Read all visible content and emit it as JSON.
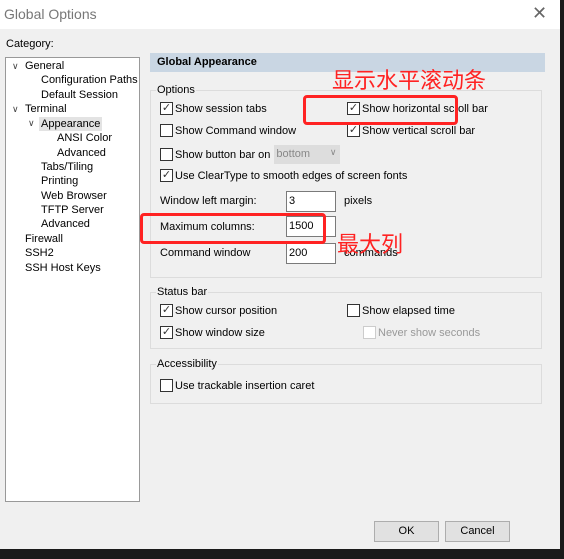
{
  "window": {
    "title": "Global Options",
    "close_icon": "close-icon"
  },
  "category_label": "Category:",
  "tree": [
    {
      "label": "General",
      "expanded": true
    },
    {
      "label": "Configuration Paths"
    },
    {
      "label": "Default Session"
    },
    {
      "label": "Terminal",
      "expanded": true
    },
    {
      "label": "Appearance",
      "expanded": true,
      "selected": true
    },
    {
      "label": "ANSI Color"
    },
    {
      "label": "Advanced"
    },
    {
      "label": "Tabs/Tiling"
    },
    {
      "label": "Printing"
    },
    {
      "label": "Web Browser"
    },
    {
      "label": "TFTP Server"
    },
    {
      "label": "Advanced"
    },
    {
      "label": "Firewall"
    },
    {
      "label": "SSH2"
    },
    {
      "label": "SSH Host Keys"
    }
  ],
  "panel": {
    "title": "Global Appearance"
  },
  "options": {
    "label": "Options",
    "show_session_tabs": {
      "label": "Show session tabs",
      "checked": true
    },
    "show_horizontal_scroll": {
      "label": "Show horizontal scroll bar",
      "checked": true
    },
    "show_command_window": {
      "label": "Show Command window",
      "checked": false
    },
    "show_vertical_scroll": {
      "label": "Show vertical scroll bar",
      "checked": true
    },
    "show_button_bar": {
      "label": "Show button bar on",
      "checked": false,
      "position": "bottom"
    },
    "cleartype": {
      "label": "Use ClearType to smooth edges of screen fonts",
      "checked": true
    },
    "left_margin": {
      "label": "Window left margin:",
      "value": "3",
      "unit": "pixels"
    },
    "max_columns": {
      "label": "Maximum columns:",
      "value": "1500"
    },
    "command_window": {
      "label": "Command window",
      "value": "200",
      "unit": "commands"
    }
  },
  "status_bar": {
    "label": "Status bar",
    "cursor_position": {
      "label": "Show cursor position",
      "checked": true
    },
    "elapsed_time": {
      "label": "Show elapsed time",
      "checked": false
    },
    "window_size": {
      "label": "Show window size",
      "checked": true
    },
    "never_seconds": {
      "label": "Never show seconds",
      "checked": false
    }
  },
  "accessibility": {
    "label": "Accessibility",
    "trackable_caret": {
      "label": "Use trackable insertion caret",
      "checked": false
    }
  },
  "annotations": {
    "horizontal": "显示水平滚动条",
    "max_columns": "最大列",
    "color": "#ff2222"
  },
  "buttons": {
    "ok": "OK",
    "cancel": "Cancel"
  }
}
